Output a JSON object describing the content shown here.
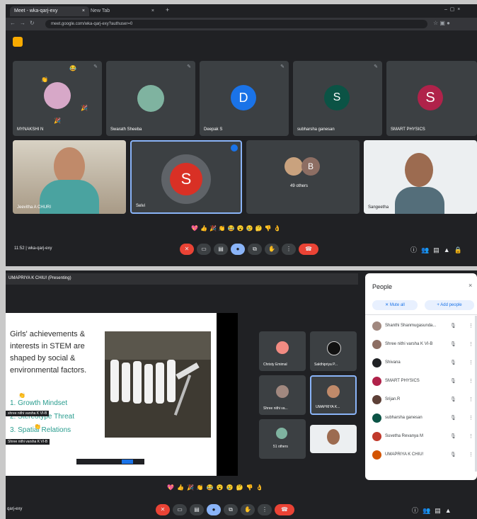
{
  "tabs": [
    {
      "label": "Meet - wka-qarj-exy"
    },
    {
      "label": "New Tab"
    }
  ],
  "address": {
    "url": "meet.google.com/wka-qarj-exy?authuser=0"
  },
  "top_tiles": [
    {
      "name": "MYNAKSHI N"
    },
    {
      "name": "Swarath Sheeba"
    },
    {
      "name": "Deepak S",
      "initial": "D"
    },
    {
      "name": "subharsha ganesan",
      "initial": "S"
    },
    {
      "name": "SMART PHYSICS",
      "initial": "S"
    },
    {
      "name": "Jeevitha A CHURI"
    },
    {
      "name": "Selvi",
      "initial": "S"
    },
    {
      "name": "49 others",
      "initial": "B"
    },
    {
      "name": "Sangeetha"
    }
  ],
  "top_bar": {
    "time": "11:52",
    "separator": "|",
    "code": "wka-qarj-exy"
  },
  "reactions": [
    "💖",
    "👍",
    "🎉",
    "👏",
    "😂",
    "😮",
    "😢",
    "🤔",
    "👎",
    "👌"
  ],
  "presenter": {
    "label": "UMAPRIYA K CHIU! (Presenting)"
  },
  "slide": {
    "text": "Girls' achievements & interests in STEM are shaped by social & environmental factors.",
    "list": [
      "1. Growth Mindset",
      "2. Stereotype Threat",
      "3. Spatial Relations"
    ],
    "caption1": "shree nithi varsha K VI-B",
    "caption2": "Shree nithi varsha K VI-B"
  },
  "side_tiles": [
    {
      "name": "Christy Emimal"
    },
    {
      "name": "Sakthipriya P..."
    },
    {
      "name": "Shree nithi va..."
    },
    {
      "name": "UMAPRIYA K..."
    },
    {
      "name": "51 others"
    }
  ],
  "people": {
    "title": "People",
    "mute_all": "Mute all",
    "add_people": "Add people",
    "rows": [
      {
        "name": "Shanthi Shanmugasunda...",
        "color": "#a1887f"
      },
      {
        "name": "Shree nithi varsha K VI-B",
        "color": "#8d6e63"
      },
      {
        "name": "Shivana",
        "color": "#202124"
      },
      {
        "name": "SMART PHYSICS",
        "color": "#b0224a"
      },
      {
        "name": "Srijan.R",
        "color": "#5d4037"
      },
      {
        "name": "subharsha ganesan",
        "color": "#0b5345"
      },
      {
        "name": "Suvetha Revanya M",
        "color": "#c0392b"
      },
      {
        "name": "UMAPRIYA K CHIU!",
        "color": "#d35400"
      }
    ]
  },
  "bottom_bar": {
    "code": "qarj-exy"
  }
}
